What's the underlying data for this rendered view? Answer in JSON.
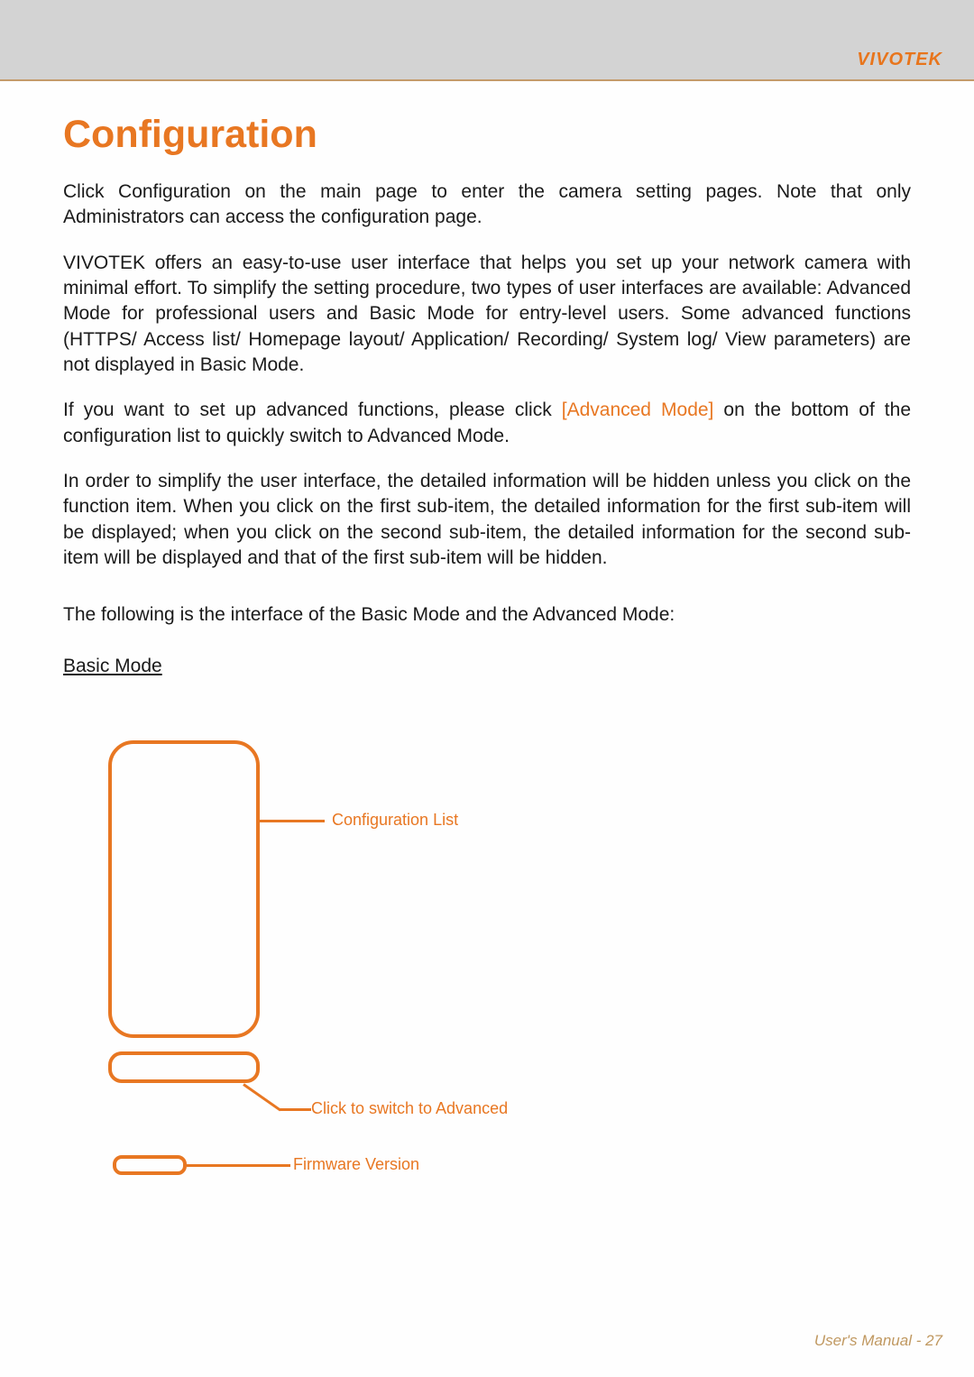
{
  "brand": "VIVOTEK",
  "page_title": "Configuration",
  "paragraphs": {
    "p1": "Click Configuration on the main page to enter the camera setting pages. Note that only Administrators can access the configuration page.",
    "p2": "VIVOTEK offers an easy-to-use user interface that helps you set up your network camera with minimal effort. To simplify the setting procedure, two types of user interfaces are available: Advanced Mode for professional users and Basic Mode for entry-level users. Some advanced functions (HTTPS/ Access list/ Homepage layout/ Application/ Recording/ System log/ View parameters) are not displayed in Basic Mode.",
    "p3_part1": "If you want to set up advanced functions, please click ",
    "p3_link": "[Advanced Mode]",
    "p3_part2": " on the bottom of the configuration list to quickly switch to Advanced Mode.",
    "p4": "In order to simplify the user interface, the detailed information will be hidden unless you click on the function item. When you click on the first sub-item, the detailed information for the first sub-item will be displayed; when you click on the second sub-item, the detailed information for the second sub-item will be displayed and that of the first sub-item will be hidden.",
    "p5": "The following is the interface of the Basic Mode and the Advanced Mode:"
  },
  "section_label": "Basic Mode ",
  "callouts": {
    "config_list": "Configuration List",
    "switch_advanced": "Click to switch to Advanced",
    "firmware": "Firmware Version"
  },
  "footer": "User's Manual - 27"
}
